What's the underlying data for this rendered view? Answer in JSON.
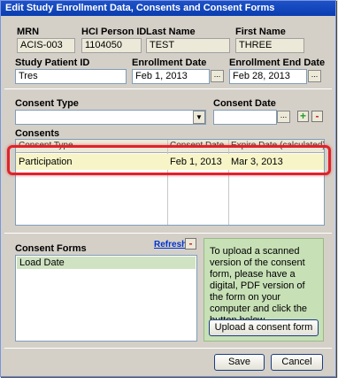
{
  "window": {
    "title": "Edit Study Enrollment Data, Consents and Consent Forms"
  },
  "fields": {
    "mrn": {
      "label": "MRN",
      "value": "ACIS-003"
    },
    "hci_person_id": {
      "label": "HCI Person ID",
      "value": "1104050"
    },
    "last_name": {
      "label": "Last Name",
      "value": "TEST"
    },
    "first_name": {
      "label": "First Name",
      "value": "THREE"
    },
    "study_patient_id": {
      "label": "Study Patient ID",
      "value": "Tres"
    },
    "enrollment_date": {
      "label": "Enrollment Date",
      "value": "Feb 1, 2013"
    },
    "enrollment_end_date": {
      "label": "Enrollment End Date",
      "value": "Feb 28, 2013"
    },
    "consent_type": {
      "label": "Consent Type",
      "value": ""
    },
    "consent_date": {
      "label": "Consent Date",
      "value": ""
    }
  },
  "buttons": {
    "dots": "...",
    "add": "+",
    "remove": "-"
  },
  "consents": {
    "label": "Consents",
    "columns": [
      "Consent Type",
      "Consent Date",
      "Expire Date (calculated)"
    ],
    "rows": [
      {
        "type": "Participation",
        "consent_date": "Feb 1, 2013",
        "expire_date": "Mar 3, 2013"
      }
    ]
  },
  "consent_forms": {
    "label": "Consent Forms",
    "refresh": "Refresh",
    "remove": "-",
    "items": [
      "Load Date"
    ]
  },
  "upload": {
    "text": "To upload a scanned version of the consent form, please have a digital, PDF version of the form on your computer and click the button below.",
    "button": "Upload a consent form"
  },
  "footer": {
    "save": "Save",
    "cancel": "Cancel"
  },
  "colors": {
    "title_bar": "#0a3db0",
    "highlight": "#e0222a",
    "row": "#f7f5c8",
    "panel": "#c7e0b6"
  }
}
